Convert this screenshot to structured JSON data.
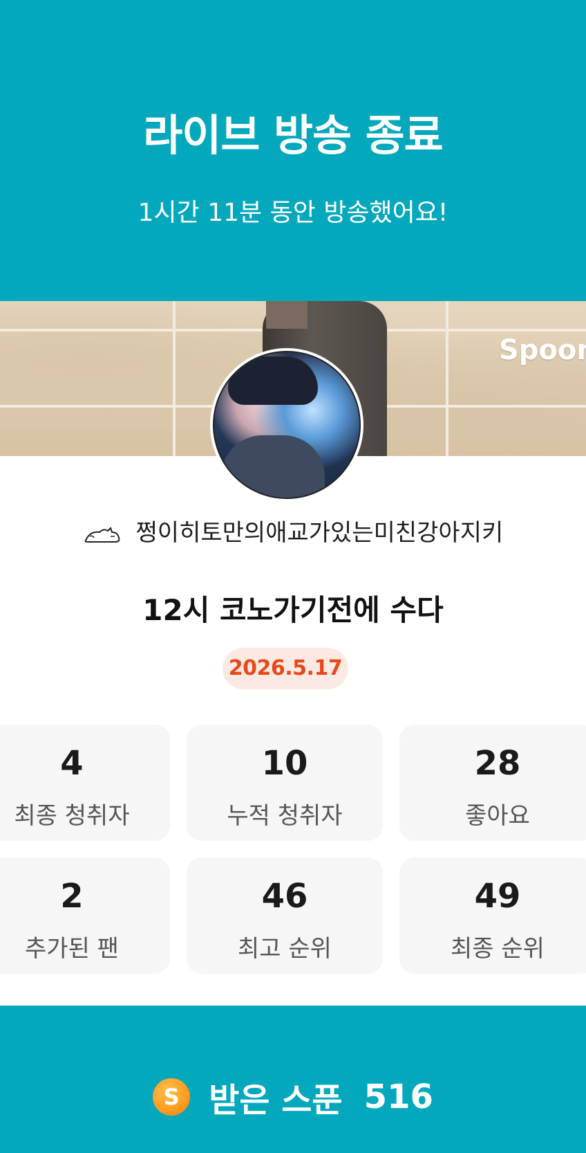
{
  "header": {
    "title": "라이브 방송 종료",
    "subtitle": "1시간 11분 동안 방송했어요!"
  },
  "banner": {
    "brand_text": "Spoon"
  },
  "profile": {
    "nickname": "쩡이히토만의애교가있는미친강아지키",
    "nickname_icon": "sleeping-cat-icon"
  },
  "live": {
    "title": "12시 코노가기전에 수다",
    "date": "2026.5.17"
  },
  "stats": [
    {
      "value": "4",
      "label": "최종 청취자"
    },
    {
      "value": "10",
      "label": "누적 청취자"
    },
    {
      "value": "28",
      "label": "좋아요"
    },
    {
      "value": "2",
      "label": "추가된 팬"
    },
    {
      "value": "46",
      "label": "최고 순위"
    },
    {
      "value": "49",
      "label": "최종 순위"
    }
  ],
  "footer": {
    "coin_letter": "S",
    "spoon_label": "받은 스푼",
    "spoon_count": "516"
  },
  "colors": {
    "accent": "#04a8bd",
    "date_text": "#e64a19",
    "date_bg": "#fde9e3",
    "coin": "#ff9a1f"
  }
}
